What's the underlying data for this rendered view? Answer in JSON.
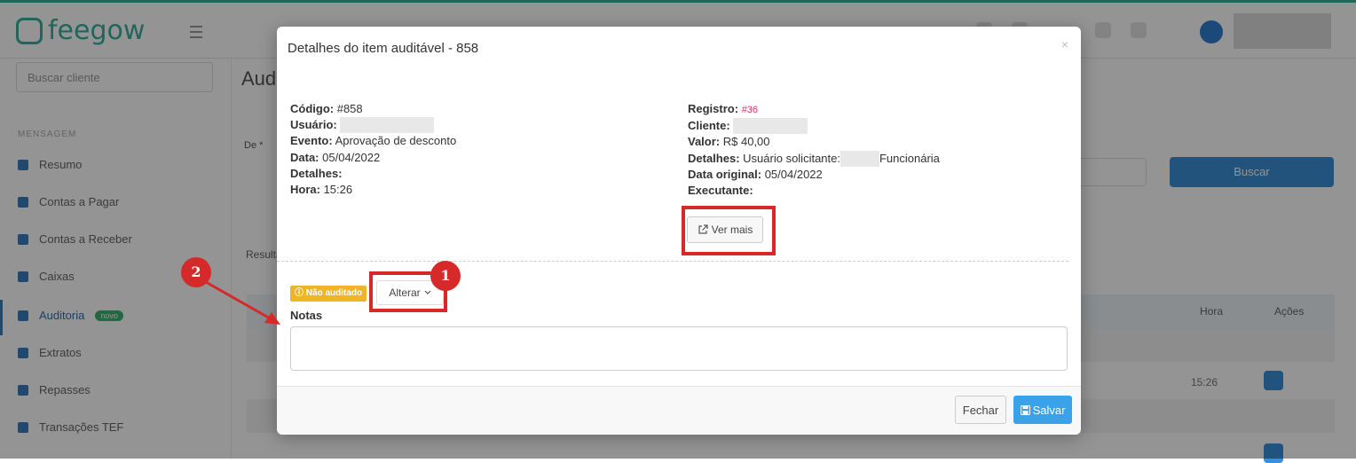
{
  "app": {
    "logo_text": "feegow",
    "page_title": "Aud",
    "search_placeholder": "Buscar cliente",
    "sidebar": {
      "section": "MENSAGEM",
      "items": [
        {
          "label": "Resumo"
        },
        {
          "label": "Contas a Pagar"
        },
        {
          "label": "Contas a Receber"
        },
        {
          "label": "Caixas"
        },
        {
          "label": "Auditoria",
          "badge": "novo"
        },
        {
          "label": "Extratos"
        },
        {
          "label": "Repasses"
        },
        {
          "label": "Transações TEF"
        }
      ]
    },
    "filter_label": "De *",
    "filter_button": "Buscar",
    "results_label": "Resultados",
    "table_headers": {
      "hora": "Hora",
      "acoes": "Ações"
    },
    "row_time": "15:26"
  },
  "modal": {
    "title": "Detalhes do item auditável - 858",
    "close": "×",
    "left": {
      "codigo_label": "Código:",
      "codigo_value": "#858",
      "usuario_label": "Usuário:",
      "evento_label": "Evento:",
      "evento_value": "Aprovação de desconto",
      "data_label": "Data:",
      "data_value": "05/04/2022",
      "detalhes_label": "Detalhes:",
      "hora_label": "Hora:",
      "hora_value": "15:26"
    },
    "right": {
      "registro_label": "Registro:",
      "registro_value": "#36",
      "cliente_label": "Cliente:",
      "valor_label": "Valor:",
      "valor_value": "R$ 40,00",
      "detalhes_label": "Detalhes:",
      "detalhes_value": "Usuário solicitante:",
      "detalhes_suffix": "Funcionária",
      "data_original_label": "Data original:",
      "data_original_value": "05/04/2022",
      "executante_label": "Executante:"
    },
    "ver_mais": "Ver mais",
    "status_badge": "Não auditado",
    "alterar": "Alterar",
    "notas_label": "Notas",
    "notas_value": "",
    "fechar": "Fechar",
    "salvar": "Salvar"
  },
  "annotations": {
    "marker1": "1",
    "marker2": "2"
  },
  "colors": {
    "highlight": "#d62a2a",
    "status": "#f0b429",
    "primary": "#3aa2e8"
  }
}
